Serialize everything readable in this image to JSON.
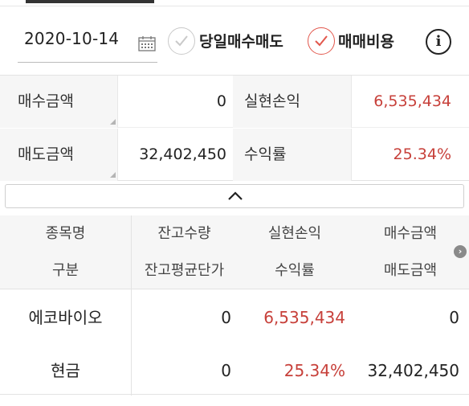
{
  "filters": {
    "date": "2020-10-14",
    "same_day_label": "당일매수매도",
    "same_day_checked": false,
    "fee_label": "매매비용",
    "fee_checked": true,
    "info_glyph": "i"
  },
  "summary": {
    "row1": {
      "label_a": "매수금액",
      "value_a": "0",
      "label_b": "실현손익",
      "value_b": "6,535,434"
    },
    "row2": {
      "label_a": "매도금액",
      "value_a": "32,402,450",
      "label_b": "수익률",
      "value_b": "25.34%"
    }
  },
  "holdings": {
    "header1": [
      "종목명",
      "잔고수량",
      "실현손익",
      "매수금액"
    ],
    "header2": [
      "구분",
      "잔고평균단가",
      "수익률",
      "매도금액"
    ],
    "rows": [
      {
        "name": "에코바이오",
        "qty": "0",
        "profit": "6,535,434",
        "buy": "0"
      },
      {
        "name": "현금",
        "qty": "0",
        "profit": "25.34%",
        "buy": "32,402,450"
      }
    ]
  },
  "colors": {
    "accent_red": "#c7403a",
    "check_on": "#e2574c",
    "header_bg": "#f6f6f6"
  },
  "icons": [
    "calendar-icon",
    "check-icon",
    "info-icon",
    "chevron-up-icon",
    "chevron-right-icon"
  ]
}
